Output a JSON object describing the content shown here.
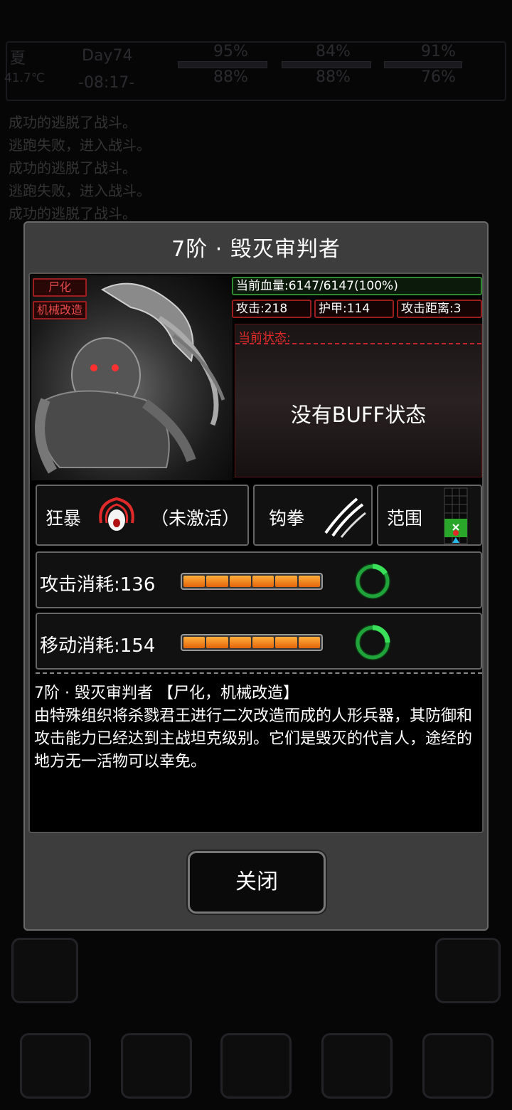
{
  "hud": {
    "season": "夏",
    "day": "Day74",
    "temperature": "41.7℃",
    "time": "-08:17-",
    "stats": [
      "95%",
      "84%",
      "91%",
      "88%",
      "88%",
      "76%"
    ]
  },
  "log": [
    "成功的逃脱了战斗。",
    "逃跑失败，进入战斗。",
    "成功的逃脱了战斗。",
    "逃跑失败，进入战斗。",
    "成功的逃脱了战斗。"
  ],
  "dialog": {
    "title": "7阶 · 毁灭审判者",
    "tags": [
      "尸化",
      "机械改造"
    ],
    "hp": "当前血量:6147/6147(100%)",
    "attack": "攻击:218",
    "armor": "护甲:114",
    "range": "攻击距离:3",
    "state_label": "当前状态:",
    "no_buff": "没有BUFF状态",
    "skills": {
      "berserk": "狂暴",
      "berserk_status": "（未激活）",
      "hook": "钩拳",
      "area": "范围"
    },
    "attack_cost": "攻击消耗:136",
    "move_cost": "移动消耗:154",
    "description_header": "7阶 · 毁灭审判者 【尸化，机械改造】",
    "description": "由特殊组织将杀戮君王进行二次改造而成的人形兵器，其防御和攻击能力已经达到主战坦克级别。它们是毁灭的代言人，途经的地方无一活物可以幸免。",
    "close": "关闭"
  },
  "colors": {
    "accent_red": "#c0262b",
    "hp_green": "#2f8a2f",
    "energy_orange": "#f08a1a"
  }
}
